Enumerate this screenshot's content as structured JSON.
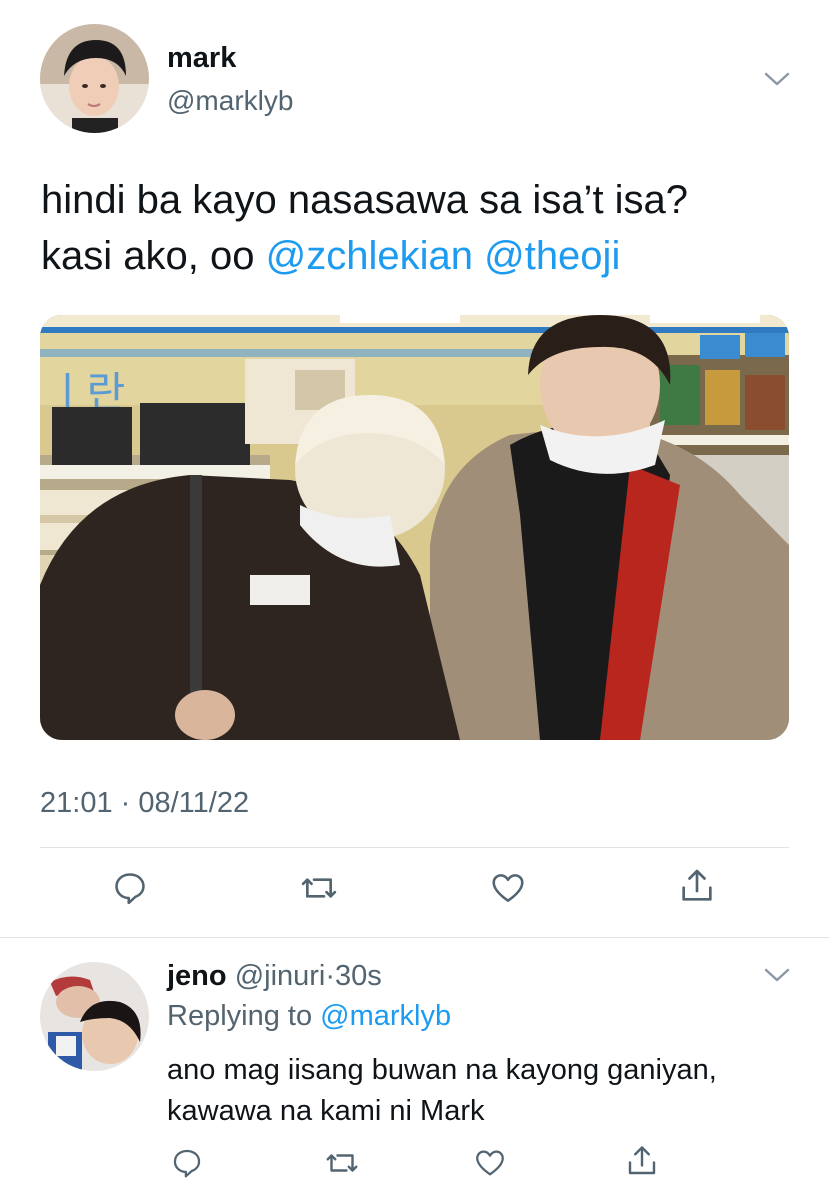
{
  "tweet": {
    "author_name": "mark",
    "author_handle": "@marklyb",
    "text_line1": "hindi ba kayo nasasawa sa isa’t isa?",
    "text_line2_prefix": "kasi ako, oo",
    "mentions": [
      "@zchlekian",
      "@theoji"
    ],
    "timestamp": "21:01 · 08/11/22"
  },
  "reply": {
    "author_name": "jeno",
    "author_handle": "@jinuri",
    "separator": "·",
    "age": "30s",
    "replying_prefix": "Replying to",
    "replying_handle": "@marklyb",
    "text_line1": "ano mag iisang buwan na kayong ganiyan,",
    "text_line2": "kawawa na kami ni Mark"
  },
  "icons": {
    "more": "chevron-down-icon",
    "reply": "reply-icon",
    "retweet": "retweet-icon",
    "like": "like-icon",
    "share": "share-icon"
  },
  "colors": {
    "link": "#1d9bf0",
    "secondary_text": "#536471",
    "primary_text": "#0f1419",
    "divider": "#dfe4e8"
  }
}
